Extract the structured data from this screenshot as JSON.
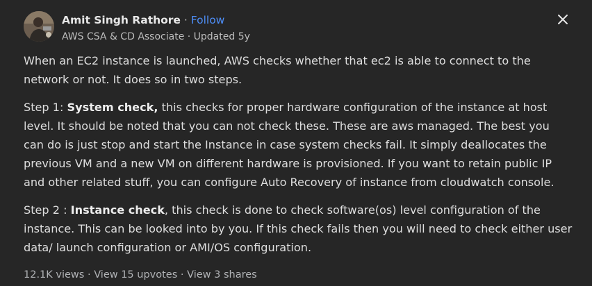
{
  "author": {
    "name": "Amit Singh Rathore",
    "separator": " · ",
    "follow_label": "Follow",
    "credential": "AWS CSA & CD Associate · Updated 5y"
  },
  "answer": {
    "intro": "When an EC2 instance is launched, AWS checks whether that ec2 is able to connect to the network or not. It does so in two steps.",
    "step1": {
      "prefix": "Step 1: ",
      "title": "System check,",
      "text": " this checks for proper hardware configuration of the instance at host level. It should be noted that you can not check these. These are aws managed. The best you can do is just stop and start the Instance in case system checks fail. It simply deallocates the previous VM and a new VM on different hardware is provisioned. If you want to retain public IP and other related stuff, you can configure Auto Recovery of instance from cloudwatch console."
    },
    "step2": {
      "prefix": "Step 2 : ",
      "title": "Instance check",
      "text": ", this check is done to check software(os) level configuration of the instance. This can be looked into by you. If this check fails then you will need to check either user data/ launch configuration or AMI/OS configuration."
    }
  },
  "stats": {
    "views": "12.1K views",
    "sep": " · ",
    "upvotes": "View 15 upvotes",
    "shares": "View 3 shares"
  },
  "icons": {
    "close": "close-icon",
    "avatar": "avatar"
  },
  "colors": {
    "background": "#262626",
    "link": "#4e8ef7",
    "text": "#dedede",
    "muted": "#b1b3b6"
  }
}
